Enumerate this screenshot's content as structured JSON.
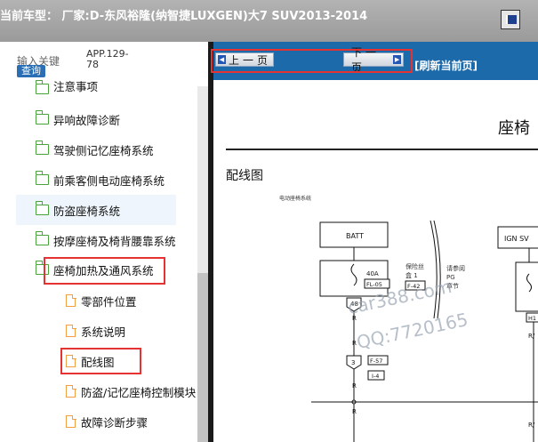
{
  "window": {
    "title": "当前车型：  厂家:D-东风裕隆(纳智捷LUXGEN)大7 SUV2013-2014"
  },
  "search": {
    "label": "输入关键",
    "button": "查询",
    "value": "APP.129-78"
  },
  "tree": {
    "items": [
      {
        "label": "注意事项",
        "type": "folder"
      },
      {
        "label": "异响故障诊断",
        "type": "folder"
      },
      {
        "label": "驾驶侧记忆座椅系统",
        "type": "folder"
      },
      {
        "label": "前乘客侧电动座椅系统",
        "type": "folder"
      },
      {
        "label": "防盗座椅系统",
        "type": "folder"
      },
      {
        "label": "按摩座椅及椅背腰靠系统",
        "type": "folder"
      },
      {
        "label": "座椅加热及通风系统",
        "type": "folder-open"
      },
      {
        "label": "零部件位置",
        "type": "page"
      },
      {
        "label": "系统说明",
        "type": "page"
      },
      {
        "label": "配线图",
        "type": "page"
      },
      {
        "label": "防盗/记忆座椅控制模块",
        "type": "page"
      },
      {
        "label": "故障诊断步骤",
        "type": "page"
      }
    ]
  },
  "toolbar": {
    "prev": "上一页",
    "next": "下一页",
    "refresh": "[刷新当前页]"
  },
  "document": {
    "heading": "座椅",
    "subheading": "配线图",
    "diagram": {
      "caption": "电动座椅系统",
      "batt": "BATT",
      "ign": "IGN SV",
      "fuse_amp": "40A",
      "fuse_id": "FL-05",
      "fuse_note1": "保险丝",
      "fuse_note2": "盒 1",
      "fuse_ref": "F-42",
      "ref_note1": "请参阅",
      "ref_note2": "PG",
      "ref_note3": "章节",
      "pin1": "48",
      "pin2": "3",
      "conn1": "F-57",
      "conn2": "I-4",
      "wire": "R",
      "right_pin": "H1",
      "right_wire": "R/"
    }
  },
  "watermark": {
    "line1": "car388.com",
    "line2": "QQ:7720165"
  },
  "colors": {
    "toolbar": "#1d6aaa",
    "highlight_box": "#e53333",
    "folder": "#4aa23a",
    "page": "#f0a040"
  }
}
